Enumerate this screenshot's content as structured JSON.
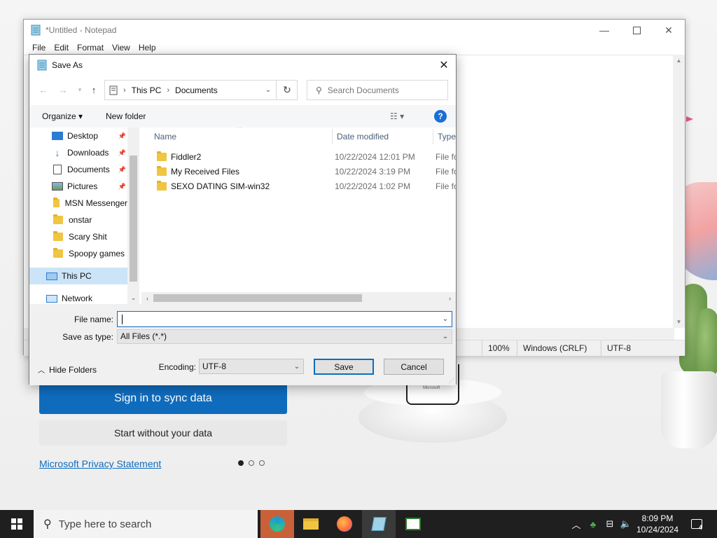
{
  "background": {
    "sync_button": "Sign in to sync data",
    "no_data_button": "Start without your data",
    "privacy_link": "Microsoft Privacy Statement",
    "phone_logo": "Microsoft"
  },
  "notepad": {
    "title": "*Untitled - Notepad",
    "menu": [
      "File",
      "Edit",
      "Format",
      "View",
      "Help"
    ],
    "status": {
      "zoom": "100%",
      "line_ending": "Windows (CRLF)",
      "encoding": "UTF-8"
    }
  },
  "dialog": {
    "title": "Save As",
    "address": {
      "crumb1": "This PC",
      "crumb2": "Documents"
    },
    "search_placeholder": "Search Documents",
    "toolbar": {
      "organize": "Organize ▾",
      "new_folder": "New folder",
      "help": "?"
    },
    "nav_items": [
      {
        "label": "Desktop",
        "pinned": true
      },
      {
        "label": "Downloads",
        "pinned": true
      },
      {
        "label": "Documents",
        "pinned": true
      },
      {
        "label": "Pictures",
        "pinned": true
      },
      {
        "label": "MSN Messenger",
        "pinned": false
      },
      {
        "label": "onstar",
        "pinned": false
      },
      {
        "label": "Scary Shit",
        "pinned": false
      },
      {
        "label": "Spoopy games",
        "pinned": false
      },
      {
        "label": "This PC",
        "pinned": false,
        "selected": true
      },
      {
        "label": "Network",
        "pinned": false
      }
    ],
    "columns": {
      "name": "Name",
      "date": "Date modified",
      "type": "Type"
    },
    "files": [
      {
        "name": "Fiddler2",
        "date": "10/22/2024 12:01 PM",
        "type": "File fo"
      },
      {
        "name": "My Received Files",
        "date": "10/22/2024 3:19 PM",
        "type": "File fo"
      },
      {
        "name": "SEXO DATING SIM-win32",
        "date": "10/22/2024 1:02 PM",
        "type": "File fo"
      }
    ],
    "file_name_label": "File name:",
    "file_name_value": "",
    "save_as_type_label": "Save as type:",
    "save_as_type_value": "All Files  (*.*)",
    "hide_folders": "Hide Folders",
    "encoding_label": "Encoding:",
    "encoding_value": "UTF-8",
    "save_button": "Save",
    "cancel_button": "Cancel"
  },
  "taskbar": {
    "search_placeholder": "Type here to search",
    "time": "8:09 PM",
    "date": "10/24/2024",
    "notification_count": "4"
  }
}
